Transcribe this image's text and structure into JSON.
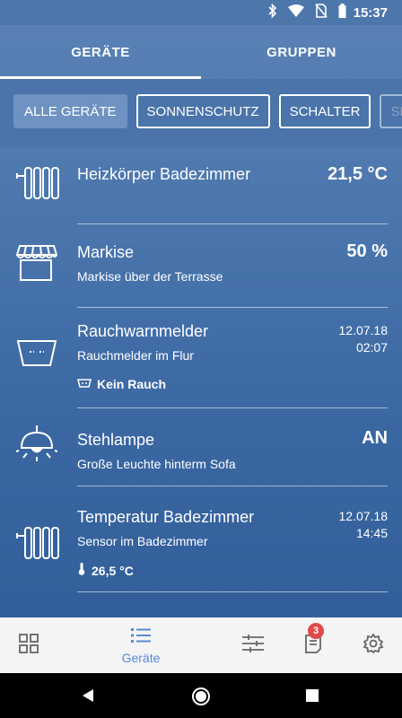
{
  "status_bar": {
    "time": "15:37"
  },
  "tabs": [
    {
      "label": "GERÄTE",
      "active": true
    },
    {
      "label": "GRUPPEN",
      "active": false
    }
  ],
  "chips": [
    {
      "label": "ALLE GERÄTE",
      "active": true
    },
    {
      "label": "SONNENSCHUTZ",
      "active": false
    },
    {
      "label": "SCHALTER",
      "active": false
    },
    {
      "label": "SE",
      "active": false
    }
  ],
  "devices": [
    {
      "icon": "radiator-icon",
      "title": "Heizkörper Badezimmer",
      "value": "21,5 °C"
    },
    {
      "icon": "awning-icon",
      "title": "Markise",
      "subtitle": "Markise über der Terrasse",
      "value": "50 %"
    },
    {
      "icon": "smoke-detector-icon",
      "title": "Rauchwarnmelder",
      "subtitle": "Rauchmelder im Flur",
      "date": "12.07.18",
      "time": "02:07",
      "status": "Kein Rauch"
    },
    {
      "icon": "lamp-icon",
      "title": "Stehlampe",
      "subtitle": "Große Leuchte hinterm Sofa",
      "value": "AN"
    },
    {
      "icon": "radiator-icon",
      "title": "Temperatur Badezimmer",
      "subtitle": "Sensor im Badezimmer",
      "date": "12.07.18",
      "time": "14:45",
      "status": "26,5 °C"
    }
  ],
  "bottom_nav": {
    "items": [
      {
        "icon": "dashboard-icon"
      },
      {
        "icon": "list-icon",
        "label": "Geräte",
        "active": true
      },
      {
        "icon": "sliders-icon"
      },
      {
        "icon": "notifications-icon",
        "badge": "3"
      },
      {
        "icon": "settings-icon"
      }
    ]
  },
  "colors": {
    "accent": "#5a8ad6",
    "badge": "#e04a4a",
    "background_top": "#5a82b6",
    "background_bottom": "#2e5b97"
  }
}
